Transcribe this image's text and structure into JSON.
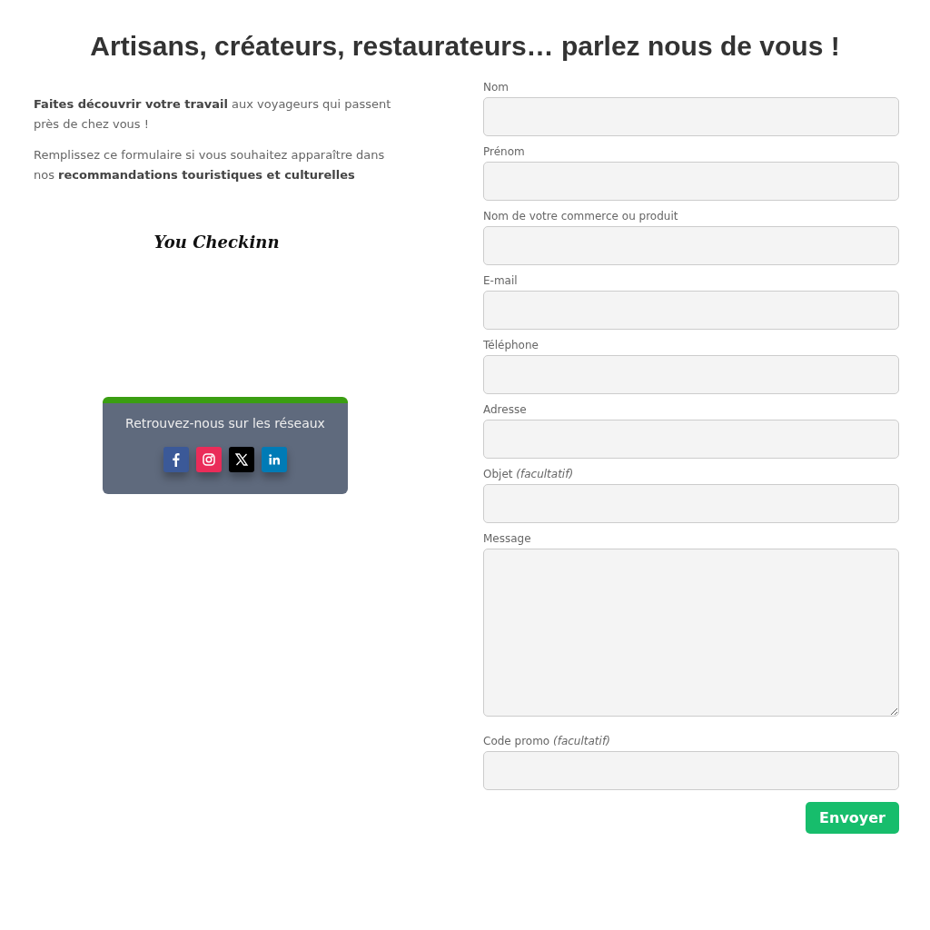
{
  "title": "Artisans, créateurs, restaurateurs… parlez nous de vous !",
  "intro": [
    "**Faites découvrir votre travail** aux voyageurs qui passent près de chez vous !",
    "Remplissez ce formulaire si vous souhaitez apparaître dans nos **recommandations touristiques et culturelles**"
  ],
  "logo": "You Checkinn",
  "social_card": {
    "title": "Retrouvez-nous sur les réseaux",
    "links": [
      {
        "kind": "facebook",
        "color": "#3b5998"
      },
      {
        "kind": "instagram",
        "color": "#ea2c59"
      },
      {
        "kind": "x",
        "color": "#000000"
      },
      {
        "kind": "linkedin",
        "color": "#007bb6"
      }
    ]
  },
  "fields": [
    {
      "label": "Nom",
      "kind": "input"
    },
    {
      "label": "Prénom",
      "kind": "input"
    },
    {
      "label": "Nom de votre commerce ou produit",
      "kind": "input"
    },
    {
      "label": "E-mail",
      "kind": "input"
    },
    {
      "label": "Téléphone",
      "kind": "input"
    },
    {
      "label": "Adresse",
      "kind": "input"
    },
    {
      "label": "Objet *(facultatif)*",
      "kind": "input"
    },
    {
      "label": "Message",
      "kind": "textarea"
    },
    {
      "label": "Code promo *(facultatif)*",
      "kind": "input"
    }
  ],
  "submit": "Envoyer"
}
